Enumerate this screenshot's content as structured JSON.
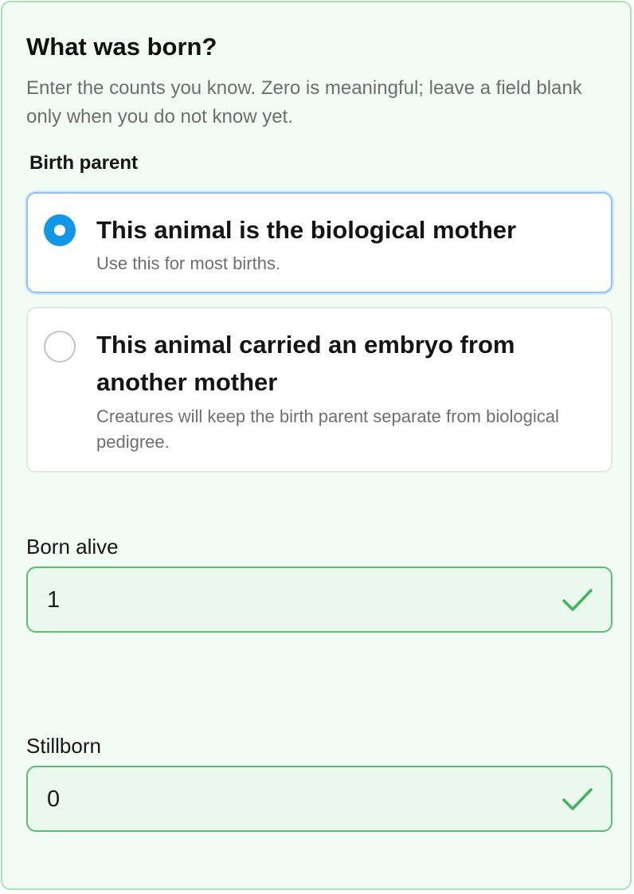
{
  "form": {
    "title": "What was born?",
    "subtitle": "Enter the counts you know. Zero is meaningful; leave a field blank only when you do not know yet."
  },
  "birth_parent": {
    "label": "Birth parent",
    "options": [
      {
        "title": "This animal is the biological mother",
        "description": "Use this for most births.",
        "selected": true
      },
      {
        "title": "This animal carried an embryo from another mother",
        "description": "Creatures will keep the birth parent separate from biological pedigree.",
        "selected": false
      }
    ]
  },
  "fields": {
    "born_alive": {
      "label": "Born alive",
      "value": "1",
      "valid_icon": "check-icon"
    },
    "stillborn": {
      "label": "Stillborn",
      "value": "0",
      "valid_icon": "check-icon"
    }
  },
  "colors": {
    "selected_radio": "#1297e8",
    "valid_green": "#3fb45a",
    "card_background": "#f2fbf4"
  }
}
